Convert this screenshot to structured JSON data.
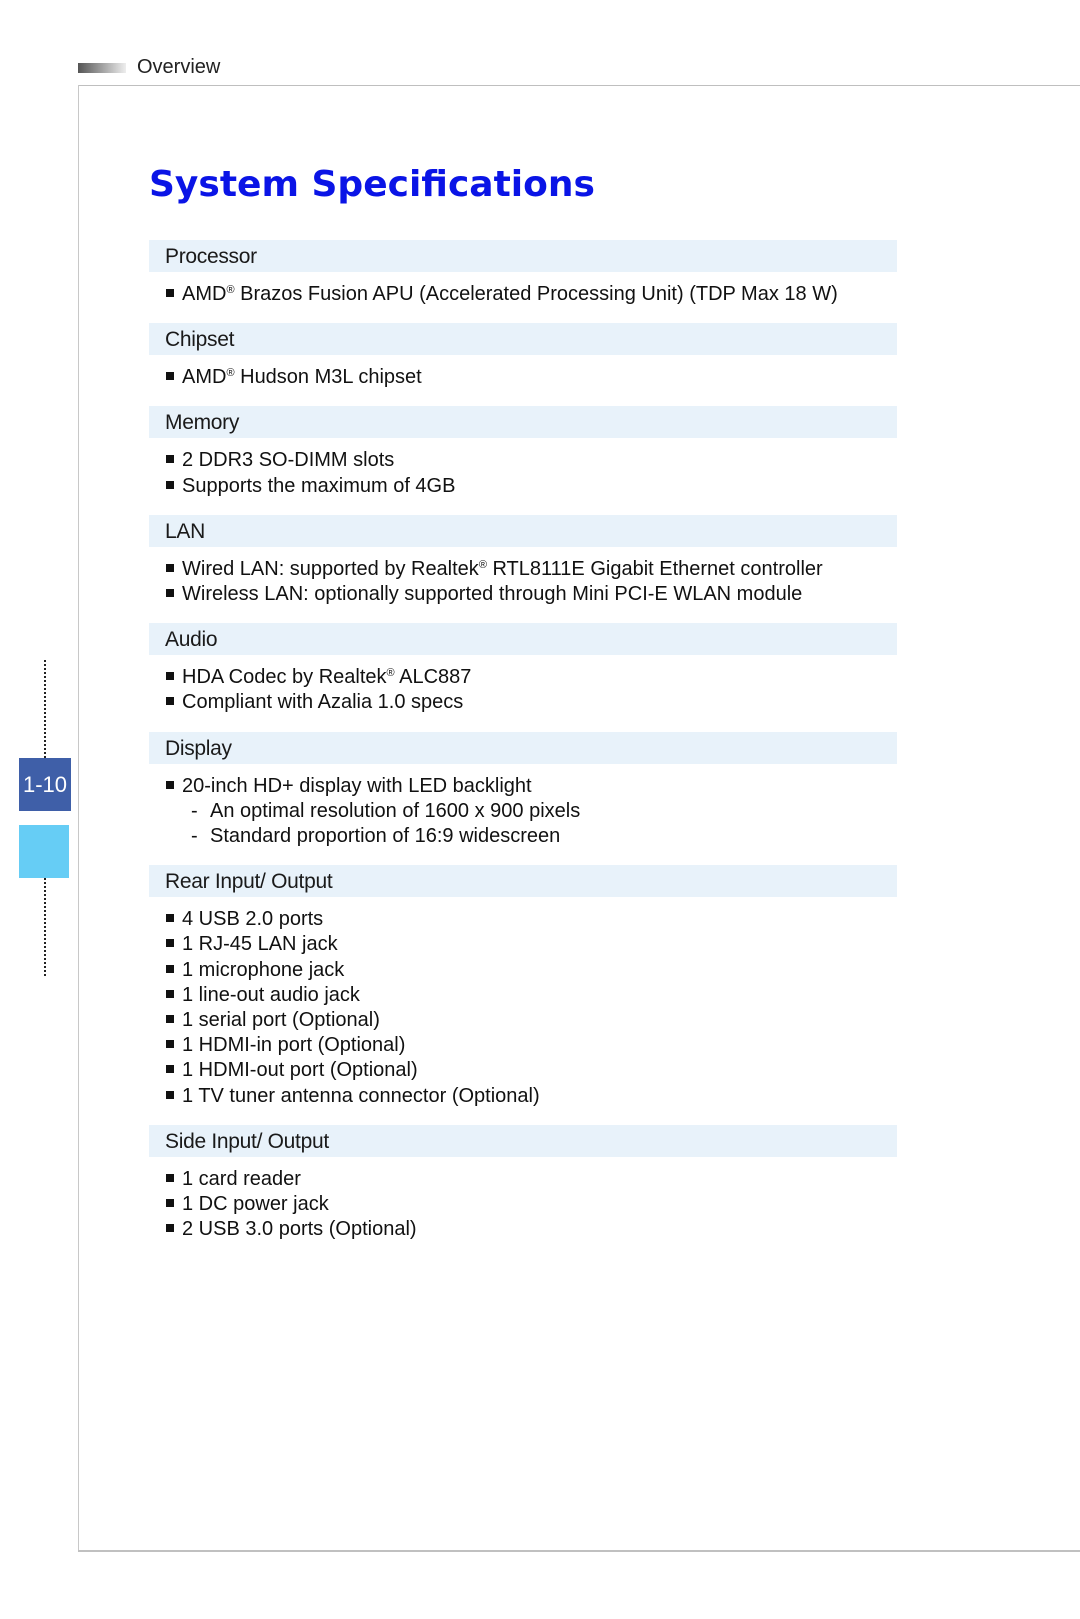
{
  "header": {
    "section_label": "Overview"
  },
  "page_number": "1-10",
  "title": "System Specifications",
  "sections": [
    {
      "heading": "Processor",
      "items": [
        {
          "pre": "AMD",
          "reg": "®",
          "post": " Brazos Fusion APU (Accelerated Processing Unit) (TDP Max 18 W)"
        }
      ]
    },
    {
      "heading": "Chipset",
      "items": [
        {
          "pre": "AMD",
          "reg": "®",
          "post": " Hudson M3L chipset"
        }
      ]
    },
    {
      "heading": "Memory",
      "items": [
        {
          "pre": "2 DDR3 SO-DIMM slots"
        },
        {
          "pre": "Supports the maximum of 4GB"
        }
      ]
    },
    {
      "heading": "LAN",
      "items": [
        {
          "pre": "Wired LAN: supported by Realtek",
          "reg": "®",
          "post": " RTL8111E Gigabit Ethernet controller"
        },
        {
          "pre": "Wireless LAN: optionally supported through Mini PCI-E WLAN module"
        }
      ]
    },
    {
      "heading": "Audio",
      "items": [
        {
          "pre": "HDA Codec by Realtek",
          "reg": "®",
          "post": " ALC887"
        },
        {
          "pre": "Compliant with Azalia 1.0 specs"
        }
      ]
    },
    {
      "heading": "Display",
      "items": [
        {
          "pre": "20-inch HD+ display with LED backlight"
        }
      ],
      "subitems": [
        "An optimal resolution of 1600 x 900 pixels",
        "Standard proportion of 16:9 widescreen"
      ]
    },
    {
      "heading": "Rear Input/ Output",
      "items": [
        {
          "pre": "4 USB 2.0 ports"
        },
        {
          "pre": "1 RJ-45 LAN jack"
        },
        {
          "pre": "1 microphone jack"
        },
        {
          "pre": "1 line-out audio jack"
        },
        {
          "pre": "1 serial port (Optional)"
        },
        {
          "pre": "1 HDMI-in port (Optional)"
        },
        {
          "pre": "1 HDMI-out port (Optional)"
        },
        {
          "pre": "1 TV tuner antenna connector (Optional)"
        }
      ]
    },
    {
      "heading": "Side Input/ Output",
      "items": [
        {
          "pre": "1 card reader"
        },
        {
          "pre": "1 DC power jack"
        },
        {
          "pre": "2 USB 3.0 ports (Optional)"
        }
      ]
    }
  ],
  "colors": {
    "title": "#0a14e6",
    "section_bg": "#e8f2fa",
    "page_badge": "#3f5fa8",
    "tab_accent": "#66cdf5"
  }
}
